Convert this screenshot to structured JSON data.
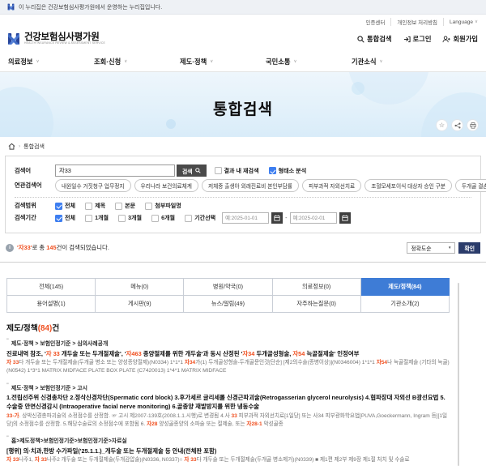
{
  "colors": {
    "accent_orange": "#f04f1f",
    "tab_active_blue": "#3e7cd6",
    "check_blue": "#3d7ef0",
    "confirm_navy": "#2b3c6b",
    "logo_blue": "#27449a"
  },
  "banner": {
    "text": "이 누리집은 건강보험심사평가원에서 운영하는 누리집입니다."
  },
  "utility": {
    "links": [
      "인증센터",
      "개인정보 처리방침",
      "Language"
    ]
  },
  "header": {
    "logo_title": "건강보험심사평가원",
    "logo_subtitle": "HEALTH INSURANCE REVIEW & ASSESSMENT SERVICE",
    "search_label": "통합검색",
    "login_label": "로그인",
    "join_label": "회원가입"
  },
  "nav": {
    "items": [
      "의료정보",
      "조회·신청",
      "제도·정책",
      "국민소통",
      "기관소식"
    ]
  },
  "hero": {
    "title": "통합검색"
  },
  "breadcrumb": {
    "separator": "›",
    "current": "통합검색"
  },
  "search_form": {
    "keyword_label": "검색어",
    "keyword_value": "자33",
    "search_button_label": "검색",
    "options": [
      {
        "label": "결과 내 재검색",
        "checked": false
      },
      {
        "label": "형태소 분석",
        "checked": true
      }
    ],
    "related_label": "연관검색어",
    "related_terms": [
      "내원일수 거짓청구 업무정지",
      "우리나라 보건의료체계",
      "저체중 출생아 외래진료비 본인부담률",
      "피부과적 자외선치료",
      "조혈모세포이식 대상자 승인 구분",
      "두개골 결손부"
    ],
    "scope_label": "검색범위",
    "scope_options": [
      {
        "label": "전체",
        "checked": true
      },
      {
        "label": "제목",
        "checked": false
      },
      {
        "label": "본문",
        "checked": false
      },
      {
        "label": "첨부파일명",
        "checked": false
      }
    ],
    "period_label": "검색기간",
    "period_options": [
      {
        "label": "전체",
        "checked": true
      },
      {
        "label": "1개월",
        "checked": false
      },
      {
        "label": "3개월",
        "checked": false
      },
      {
        "label": "6개월",
        "checked": false
      },
      {
        "label": "기간선택",
        "checked": false
      }
    ],
    "date_from_placeholder": "예:2025-01-01",
    "date_to_placeholder": "예:2025-02-01",
    "date_separator": "-"
  },
  "result_bar": {
    "message_segments": [
      [
        "'자33'",
        1
      ],
      [
        "로 총 ",
        0
      ],
      [
        "145",
        1
      ],
      [
        "건이 검색되었습니다.",
        0
      ]
    ],
    "sort_value": "정확도순",
    "confirm_label": "확인"
  },
  "tabs": {
    "rows": [
      [
        {
          "label": "전체(145)",
          "active": false
        },
        {
          "label": "메뉴(0)",
          "active": false
        },
        {
          "label": "병원/약국(0)",
          "active": false
        },
        {
          "label": "의료정보(0)",
          "active": false
        },
        {
          "label": "제도/정책(84)",
          "active": true
        }
      ],
      [
        {
          "label": "용어설명(1)",
          "active": false
        },
        {
          "label": "게시판(9)",
          "active": false
        },
        {
          "label": "뉴스/알림(49)",
          "active": false
        },
        {
          "label": "자주하는질문(0)",
          "active": false
        },
        {
          "label": "기관소개(2)",
          "active": false
        }
      ]
    ]
  },
  "section": {
    "name": "제도/정책",
    "count": "(84)",
    "unit": "건"
  },
  "results": [
    {
      "path": "제도·정책 > 보험인정기준 > 심의사례공개",
      "title": [
        [
          "진료내역 참조, '",
          0
        ],
        [
          "자 33",
          1
        ],
        [
          " 개두술 또는 두개절제술', '",
          0
        ],
        [
          "자463",
          1
        ],
        [
          " 종양절제를 위한 개두술'과 동시 산정된 '",
          0
        ],
        [
          "자34",
          1
        ],
        [
          " 두개골성형술, ",
          0
        ],
        [
          "자54",
          1
        ],
        [
          " 늑골절제술' 인정여부",
          0
        ]
      ],
      "body": [
        [
          "자 33",
          1
        ],
        [
          "다 개두술 또는 두개절제술(두개골 병소 또는 양성종양절제)(N0334) 1*1*1 ",
          0
        ],
        [
          "자34",
          1
        ],
        [
          "가(1) 두개골성형술-두개골문인것[단순] [제2의수술(종병이상)](N0346004) 1*1*1 ",
          0
        ],
        [
          "자54",
          1
        ],
        [
          "나 늑골절제술 (기타의 늑골) (N0542) 1*3*1 MATRIX MIDFACE PLATE BOX PLATE (C7420013) 1*4*1 MATRIX MIDFACE",
          0
        ]
      ]
    },
    {
      "path": "제도·정책 > 보험인정기준 > 고시",
      "title": [
        [
          "1.전립선주위 신경총차단 2.정삭신경차단(Spermatic cord block) 3.후가세르 글리세롤 신경근파괴술(Retrogasserian glycerol neurolysis) 4.협파장대 자외선 B광선요법 5.수술중 안면신경감시 (Intraoperative facial nerve monitoring) 6.골종양 재발방지를 위한 냉동수술",
          0
        ]
      ],
      "body": [
        [
          "33-가",
          1
        ],
        [
          ". 상박신경총파괴술의 소정점수를 산정함. ☞ 고시 제2007-139호(2008.1.1.시행)로 변경됨 4.사 ",
          0
        ],
        [
          "33",
          1
        ],
        [
          " 피부과적 자외선치료[1일당] 또는 사34 피부광화학요법[PUVA,Goeckermann, Ingram 등][1일당]의 소정점수를 산정함. 5.해당수술료의 소정점수에 포함됨 6. ",
          0
        ],
        [
          "자28",
          1
        ],
        [
          " 양성골종양의 소파술 또는 절제술, 또는 ",
          0
        ],
        [
          "자28-1",
          1
        ],
        [
          " 악성골종",
          0
        ]
      ]
    },
    {
      "path": "홈>제도정책>보험인정기준>보험인정기준>자료실",
      "title": [
        [
          "[행위] 의·치과,한방 수가파일('25.1.1.)_개두술 또는 두개절제술 등 안내(전체판 포함)",
          0
        ]
      ],
      "body": [
        [
          "자 33",
          1
        ],
        [
          "나주1, ",
          0
        ],
        [
          "자 33",
          1
        ],
        [
          "나주2 개두술 또는 두개절제술(두개감압술)(N0336, N0337)○ ",
          0
        ],
        [
          "자 33",
          1
        ],
        [
          "다 개두술 또는 두개절제술(두개골 병소제거)(N0339) ■ 제1편 제2부 제9장 제1절 처치 및 수술료",
          0
        ]
      ]
    }
  ]
}
